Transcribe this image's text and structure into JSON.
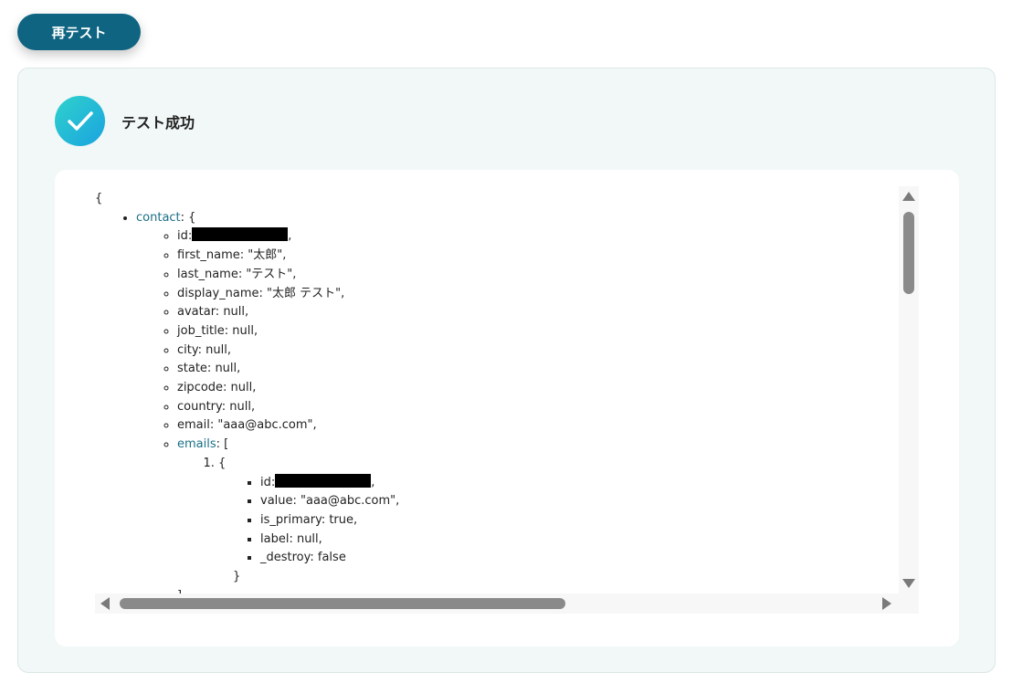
{
  "retest_button": {
    "label": "再テスト"
  },
  "result": {
    "status_title": "テスト成功",
    "icon": "check-icon",
    "colors": {
      "accent": "#0e6481",
      "success_gradient_start": "#2fd2cc",
      "success_gradient_end": "#1aa3e0",
      "key_color": "#1a6f86",
      "panel_bg": "#f1f8f7"
    }
  },
  "json_view": {
    "open_brace": "{",
    "contact_key": "contact",
    "contact_suffix": ": {",
    "contact_fields": {
      "id_prefix": "id:",
      "id_suffix": ",",
      "first_name": "first_name: \"太郎\",",
      "last_name": "last_name: \"テスト\",",
      "display_name": "display_name: \"太郎 テスト\",",
      "avatar": "avatar: null,",
      "job_title": "job_title: null,",
      "city": "city: null,",
      "state": "state: null,",
      "zipcode": "zipcode: null,",
      "country": "country: null,",
      "email": "email: \"aaa@abc.com\","
    },
    "emails_key": "emails",
    "emails_suffix": ": [",
    "email_item_open": "{",
    "email_item_fields": {
      "id_prefix": "id:",
      "id_suffix": ",",
      "value": "value: \"aaa@abc.com\",",
      "is_primary": "is_primary: true,",
      "label": "label: null,",
      "destroy": "_destroy: false"
    },
    "email_item_close": "}",
    "emails_close": "]"
  }
}
